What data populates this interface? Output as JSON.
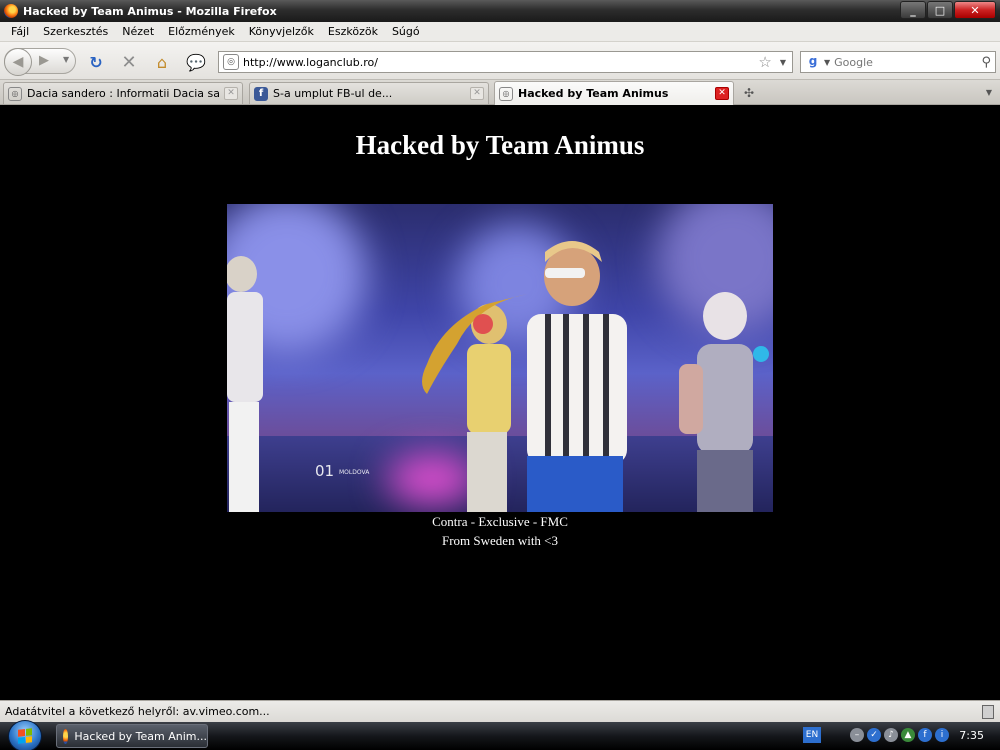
{
  "window": {
    "title": "Hacked by Team Animus - Mozilla Firefox",
    "minimize": "_",
    "maximize": "□",
    "close": "✕"
  },
  "menu": {
    "items": [
      "Fájl",
      "Szerkesztés",
      "Nézet",
      "Előzmények",
      "Könyvjelzők",
      "Eszközök",
      "Súgó"
    ]
  },
  "navbar": {
    "back_icon": "back-arrow-icon",
    "forward_icon": "forward-arrow-icon",
    "reload_icon": "reload-icon",
    "stop_icon": "stop-icon",
    "home_icon": "home-icon",
    "url": "http://www.loganclub.ro/",
    "search_engine": "google-icon",
    "search_placeholder": "Google"
  },
  "tabs": [
    {
      "label": "Dacia sandero : Informatii Dacia sandero",
      "favicon": "site-icon",
      "active": false
    },
    {
      "label": "S-a umplut FB-ul de...",
      "favicon": "facebook-icon",
      "active": false
    },
    {
      "label": "Hacked by Team Animus",
      "favicon": "site-icon",
      "active": true
    }
  ],
  "page": {
    "heading": "Hacked by Team Animus",
    "video_overlay": "01",
    "video_overlay_small": "MOLDOVA",
    "caption_line1": "Contra - Exclusive - FMC",
    "caption_line2": "From Sweden with <3"
  },
  "status": {
    "text": "Adatátvitel a következő helyről: av.vimeo.com..."
  },
  "taskbar": {
    "task_label": "Hacked by Team Anim...",
    "language": "EN",
    "clock": "7:35"
  },
  "colors": {
    "page_background": "#000000",
    "page_text": "#ffffff",
    "tab_close_active": "#dd2222"
  }
}
